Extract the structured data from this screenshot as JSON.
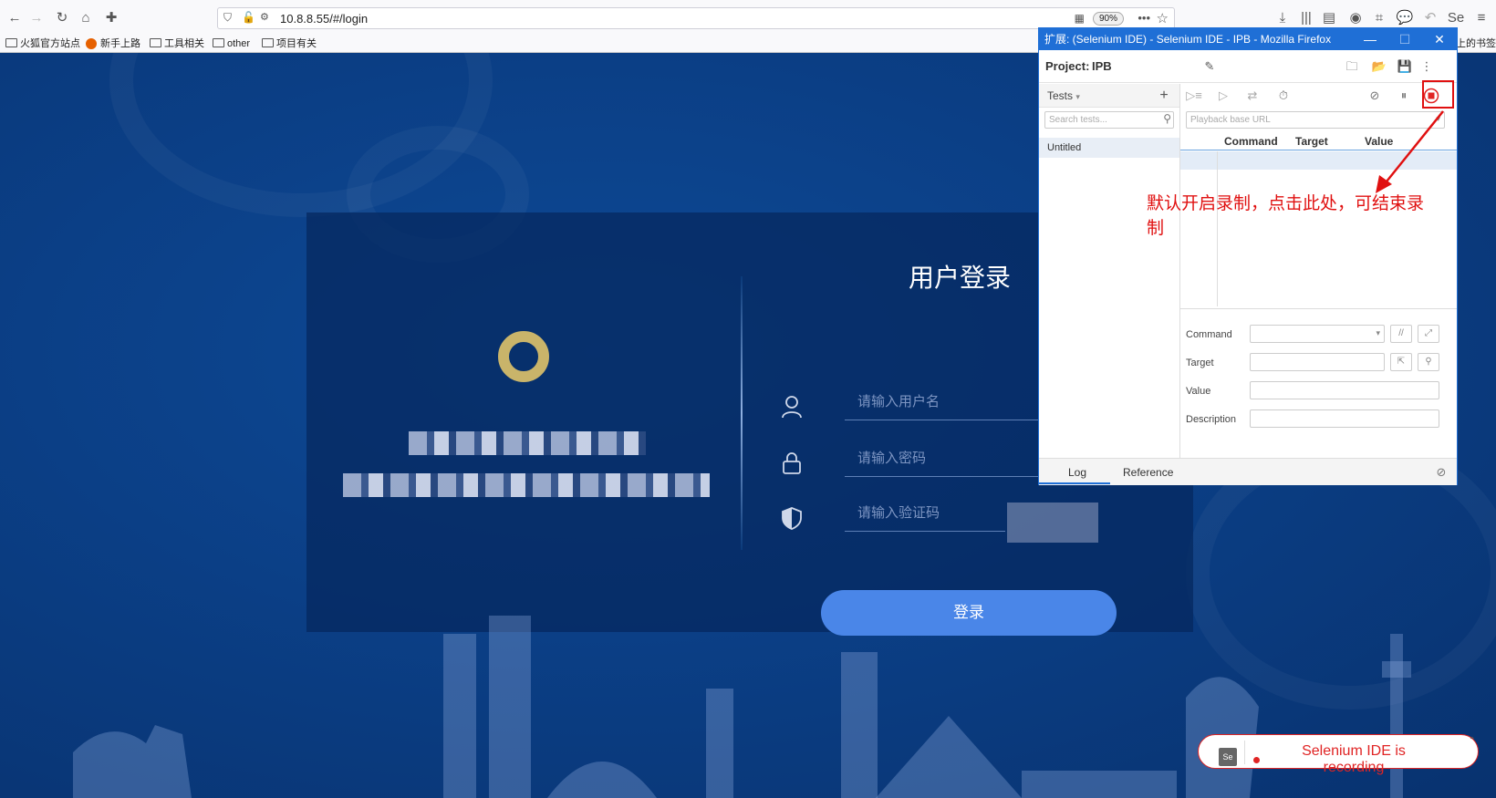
{
  "browser": {
    "url": "10.8.8.55/#/login",
    "zoom": "90%",
    "bookmarks": [
      "火狐官方站点",
      "新手上路",
      "工具相关",
      "other",
      "项目有关"
    ],
    "bookmarks_right": "上的书签"
  },
  "login": {
    "title": "用户登录",
    "username_placeholder": "请输入用户名",
    "password_placeholder": "请输入密码",
    "captcha_placeholder": "请输入验证码",
    "login_button": "登录"
  },
  "selenium": {
    "window_title": "扩展: (Selenium IDE) - Selenium IDE - IPB - Mozilla Firefox",
    "project_label": "Project:",
    "project_name": "IPB",
    "tests_label": "Tests",
    "search_placeholder": "Search tests...",
    "test_items": [
      "Untitled"
    ],
    "playback_placeholder": "Playback base URL",
    "columns": [
      "Command",
      "Target",
      "Value"
    ],
    "editor_labels": [
      "Command",
      "Target",
      "Value",
      "Description"
    ],
    "footer_tabs": [
      "Log",
      "Reference"
    ]
  },
  "annotation": {
    "text": "默认开启录制，点击此处，可结束录制",
    "color": "#e01010"
  },
  "notification": {
    "text": "Selenium IDE is recording",
    "logo": "Se"
  },
  "colors": {
    "page_bg": "#0b3f86",
    "login_button": "#4a86e8",
    "ide_titlebar": "#1f6fd6",
    "record_red": "#e02424"
  }
}
